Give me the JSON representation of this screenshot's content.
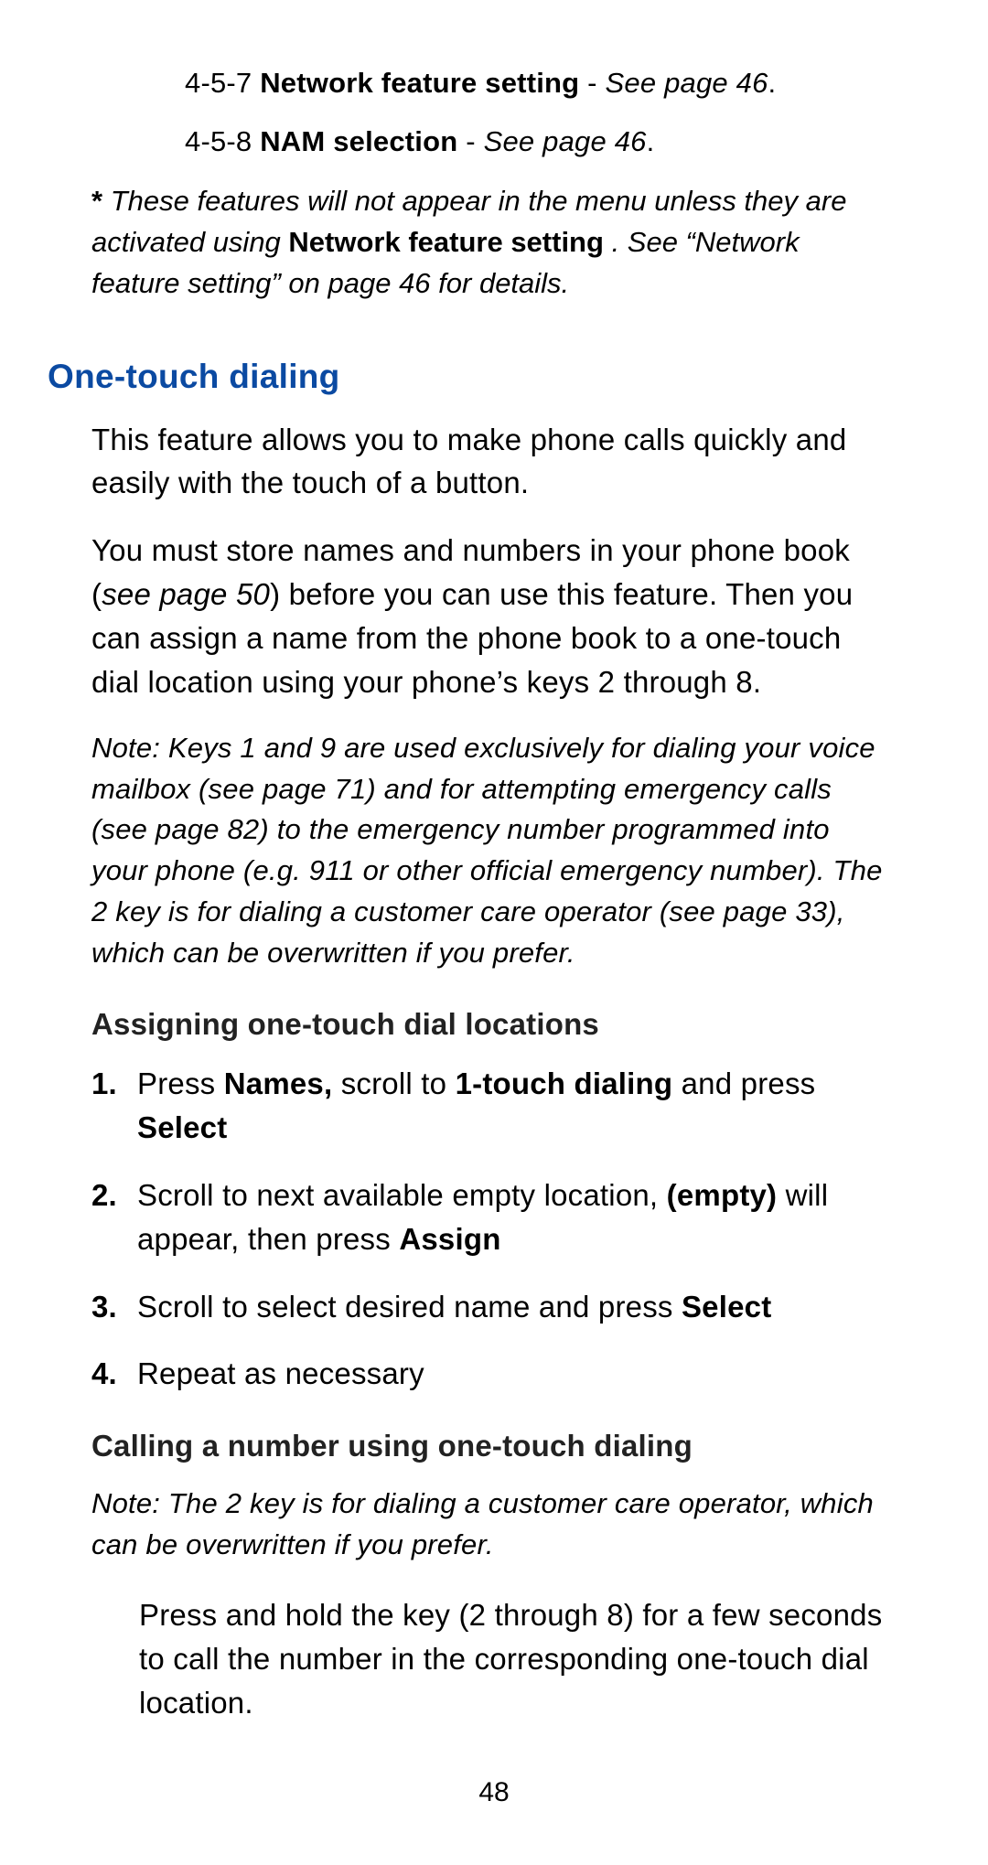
{
  "menu_items": [
    {
      "code": "4-5-7",
      "title": "Network feature setting",
      "see": "See page 46"
    },
    {
      "code": "4-5-8",
      "title": "NAM selection",
      "see": "See page 46"
    }
  ],
  "footnote": {
    "star": "*",
    "pre": "These features will not appear in the menu unless they are ac­tivated using ",
    "bold": "Network feature setting",
    "post": ". See “Network feature setting” on page 46 for details."
  },
  "section_title": "One-touch dialing",
  "intro1": "This feature allows you to make phone calls quickly and easily with the touch of a button.",
  "intro2": {
    "pre": "You must store names and numbers in your phone book (",
    "ital": "see page 50",
    "post": ") before you can use this feature. Then you can assign a name from the phone book to a one-touch dial location using your phone’s keys 2 through 8."
  },
  "note1": "Note: Keys 1 and 9 are used exclusively for dialing your voice mailbox (see page 71) and for attempting emergency calls (see page 82) to the emergency number programmed into your phone (e.g. 911 or other official emergency number). The 2 key is for dialing a customer care operator (see page 33), which can be overwritten if you prefer.",
  "sub1": "Assigning one-touch dial locations",
  "steps": [
    {
      "num": "1.",
      "parts": [
        {
          "t": "Press "
        },
        {
          "t": "Names,",
          "b": true
        },
        {
          "t": " scroll to "
        },
        {
          "t": "1-touch dialing",
          "b": true
        },
        {
          "t": " and press "
        },
        {
          "t": "Select",
          "b": true
        }
      ]
    },
    {
      "num": "2.",
      "parts": [
        {
          "t": "Scroll to next available empty location, "
        },
        {
          "t": "(empty)",
          "b": true
        },
        {
          "t": " will appear, then press "
        },
        {
          "t": "Assign",
          "b": true
        }
      ]
    },
    {
      "num": "3.",
      "parts": [
        {
          "t": "Scroll to select desired name and press "
        },
        {
          "t": "Select",
          "b": true
        }
      ]
    },
    {
      "num": "4.",
      "parts": [
        {
          "t": "Repeat as necessary"
        }
      ]
    }
  ],
  "sub2": "Calling a number using one-touch dialing",
  "note2": "Note: The 2 key is for dialing a customer care operator, which can be overwritten if you prefer.",
  "callbody": "Press and hold the key (2 through 8) for a few seconds to call the number in the corresponding one-touch dial location.",
  "page_number": "48"
}
